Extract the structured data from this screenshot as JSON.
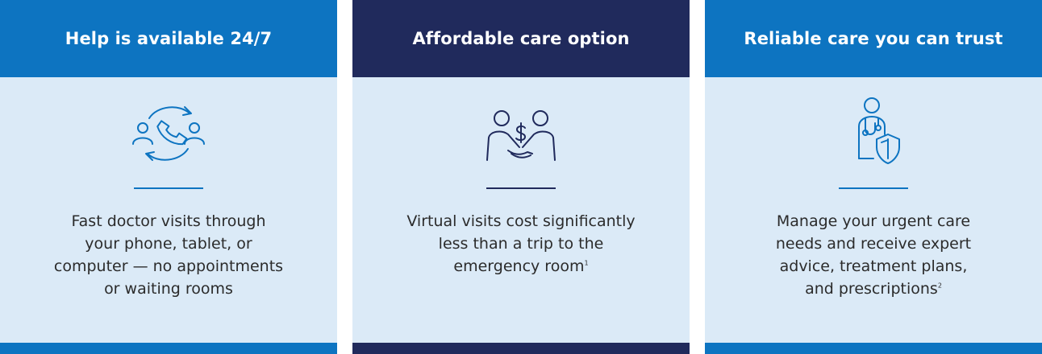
{
  "colors": {
    "blue": "#0d74c1",
    "navy": "#202a5c",
    "panel": "#dbeaf7",
    "icon_blue": "#0d74c1",
    "icon_navy": "#202a5c"
  },
  "cards": [
    {
      "title": "Help is available 24/7",
      "icon": "phone-support-cycle-icon",
      "lines": [
        "Fast doctor visits through",
        "your phone, tablet, or",
        "computer — no appointments",
        "or waiting rooms"
      ],
      "footnote": ""
    },
    {
      "title": "Affordable care option",
      "icon": "handshake-dollar-icon",
      "lines": [
        "Virtual visits cost significantly",
        "less than a trip to the",
        "emergency room"
      ],
      "footnote": "1"
    },
    {
      "title": "Reliable care you can trust",
      "icon": "doctor-shield-icon",
      "lines": [
        "Manage your urgent care",
        "needs and receive expert",
        "advice, treatment plans,",
        "and prescriptions"
      ],
      "footnote": "2"
    }
  ]
}
